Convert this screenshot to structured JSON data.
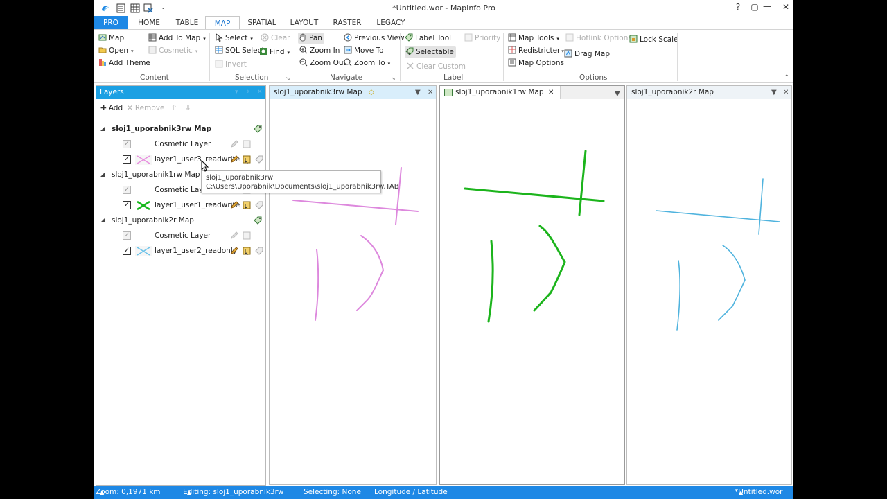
{
  "window": {
    "title": "*Untitled.wor - MapInfo Pro",
    "help": "?",
    "restore": "▢",
    "minimize": "—",
    "maximize": "☐",
    "close": "✕"
  },
  "tabs": [
    "PRO",
    "HOME",
    "TABLE",
    "MAP",
    "SPATIAL",
    "LAYOUT",
    "RASTER",
    "LEGACY"
  ],
  "active_tab": "MAP",
  "ribbon": {
    "content": {
      "map": "Map",
      "add_to_map": "Add To Map",
      "open": "Open",
      "cosmetic": "Cosmetic",
      "add_theme": "Add Theme",
      "label": "Content"
    },
    "selection": {
      "select": "Select",
      "clear": "Clear",
      "sql_select": "SQL Select",
      "find": "Find",
      "invert": "Invert",
      "label": "Selection"
    },
    "navigate": {
      "pan": "Pan",
      "previous_view": "Previous View",
      "zoom_in": "Zoom In",
      "move_to": "Move To",
      "zoom_out": "Zoom Out",
      "zoom_to": "Zoom To",
      "label": "Navigate"
    },
    "label_group": {
      "label_tool": "Label Tool",
      "priority": "Priority",
      "selectable": "Selectable",
      "clear_custom": "Clear Custom",
      "label": "Label"
    },
    "options": {
      "map_tools": "Map Tools",
      "hotlink_options": "Hotlink Options",
      "lock_scale": "Lock Scale",
      "redistricter": "Redistricter",
      "drag_map": "Drag Map",
      "map_options": "Map Options",
      "label": "Options"
    }
  },
  "layers_panel": {
    "title": "Layers",
    "add": "Add",
    "remove": "Remove",
    "groups": [
      {
        "name": "sloj1_uporabnik3rw Map",
        "cosmetic": "Cosmetic Layer",
        "layer": "layer1_user3_readwrite",
        "color": "#e88ee0"
      },
      {
        "name": "sloj1_uporabnik1rw Map",
        "cosmetic": "Cosmetic Layer",
        "layer": "layer1_user1_readwrite",
        "color": "#17b81d"
      },
      {
        "name": "sloj1_uporabnik2r Map",
        "cosmetic": "Cosmetic Layer",
        "layer": "layer1_user2_readonly",
        "color": "#6cc3ea"
      }
    ]
  },
  "tooltip": {
    "line1": "sloj1_uporabnik3rw",
    "line2": "C:\\Users\\Uporabnik\\Documents\\sloj1_uporabnik3rw.TAB"
  },
  "maps": [
    {
      "title": "sloj1_uporabnik3rw Map",
      "color": "#dd88dd"
    },
    {
      "title": "sloj1_uporabnik1rw Map",
      "color": "#1cb41c"
    },
    {
      "title": "sloj1_uporabnik2r Map",
      "color": "#4fb3de"
    }
  ],
  "status": {
    "zoom": "Zoom: 0,1971 km",
    "editing": "Editing: sloj1_uporabnik3rw",
    "selecting": "Selecting: None",
    "projection": "Longitude / Latitude",
    "workspace": "*Untitled.wor"
  }
}
